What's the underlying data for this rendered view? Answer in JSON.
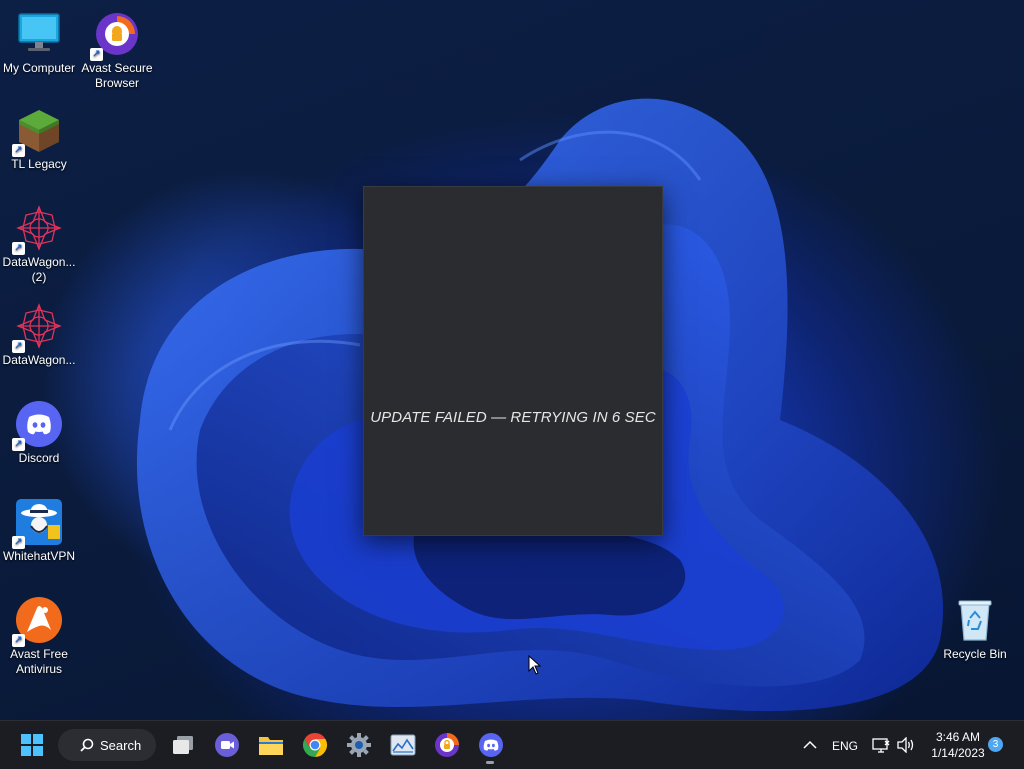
{
  "desktop": {
    "icons": [
      {
        "label": "My Computer",
        "icon": "monitor-icon",
        "shortcut": false
      },
      {
        "label": "Avast Secure Browser",
        "icon": "avast-browser-icon",
        "shortcut": true
      },
      {
        "label": "TL Legacy",
        "icon": "minecraft-grass-block-icon",
        "shortcut": true
      },
      {
        "label": "DataWagon... (2)",
        "icon": "datawagon-icon",
        "shortcut": true
      },
      {
        "label": "DataWagon...",
        "icon": "datawagon-icon",
        "shortcut": true
      },
      {
        "label": "Discord",
        "icon": "discord-icon",
        "shortcut": true
      },
      {
        "label": "WhitehatVPN",
        "icon": "whitehat-vpn-icon",
        "shortcut": true
      },
      {
        "label": "Avast Free Antivirus",
        "icon": "avast-antivirus-icon",
        "shortcut": true
      },
      {
        "label": "Recycle Bin",
        "icon": "recycle-bin-icon",
        "shortcut": false
      }
    ]
  },
  "dialog": {
    "message": "UPDATE FAILED — RETRYING IN 6 SEC"
  },
  "taskbar": {
    "search_label": "Search",
    "pinned": [
      "start-icon",
      "search-icon",
      "task-view-icon",
      "meet-icon",
      "file-explorer-icon",
      "chrome-icon",
      "settings-icon",
      "photos-icon",
      "avast-browser-icon",
      "discord-icon"
    ],
    "language": "ENG",
    "time": "3:46 AM",
    "date": "1/14/2023",
    "notification_count": "3"
  },
  "colors": {
    "accent": "#1e4ae0",
    "taskbar": "#1c1d22",
    "dialog": "#2b2c2f",
    "discord": "#5865f2",
    "avast_orange": "#f26b1d"
  }
}
